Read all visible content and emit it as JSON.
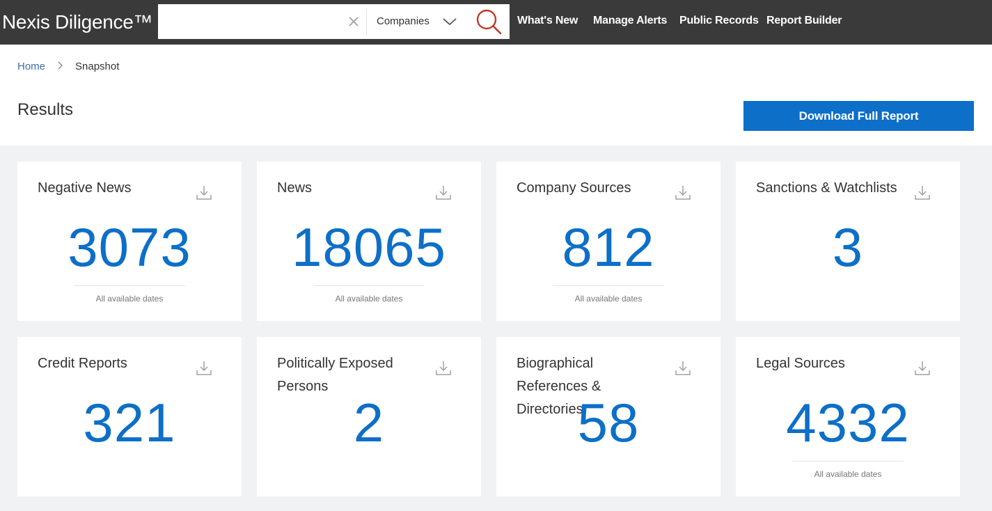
{
  "app": {
    "brand": "Nexis Diligence™"
  },
  "search": {
    "value": "",
    "placeholder": "",
    "scope": "Companies"
  },
  "nav": {
    "items": [
      "What's New",
      "Manage Alerts",
      "Public Records",
      "Report Builder"
    ]
  },
  "breadcrumb": {
    "home": "Home",
    "current": "Snapshot"
  },
  "page": {
    "title": "Results",
    "download_label": "Download Full Report"
  },
  "cards": [
    {
      "title": "Negative News",
      "count": "3073",
      "sub": "All available dates"
    },
    {
      "title": "News",
      "count": "18065",
      "sub": "All available dates"
    },
    {
      "title": "Company Sources",
      "count": "812",
      "sub": "All available dates"
    },
    {
      "title": "Sanctions & Watchlists",
      "count": "3",
      "sub": ""
    },
    {
      "title": "Credit Reports",
      "count": "321",
      "sub": ""
    },
    {
      "title": "Politically Exposed Persons",
      "count": "2",
      "sub": ""
    },
    {
      "title": "Biographical References & Directories",
      "count": "58",
      "sub": ""
    },
    {
      "title": "Legal Sources",
      "count": "4332",
      "sub": "All available dates"
    }
  ],
  "icons": {
    "clear": "close-icon",
    "scope": "chevron-down-icon",
    "search": "search-icon",
    "breadcrumb": "chevron-right-icon",
    "card_action": "download-icon"
  },
  "colors": {
    "topbar": "#3a3a3a",
    "accent": "#0d6fc8",
    "search_icon": "#c0392b",
    "link": "#3a6ea8",
    "background": "#f1f2f4"
  }
}
